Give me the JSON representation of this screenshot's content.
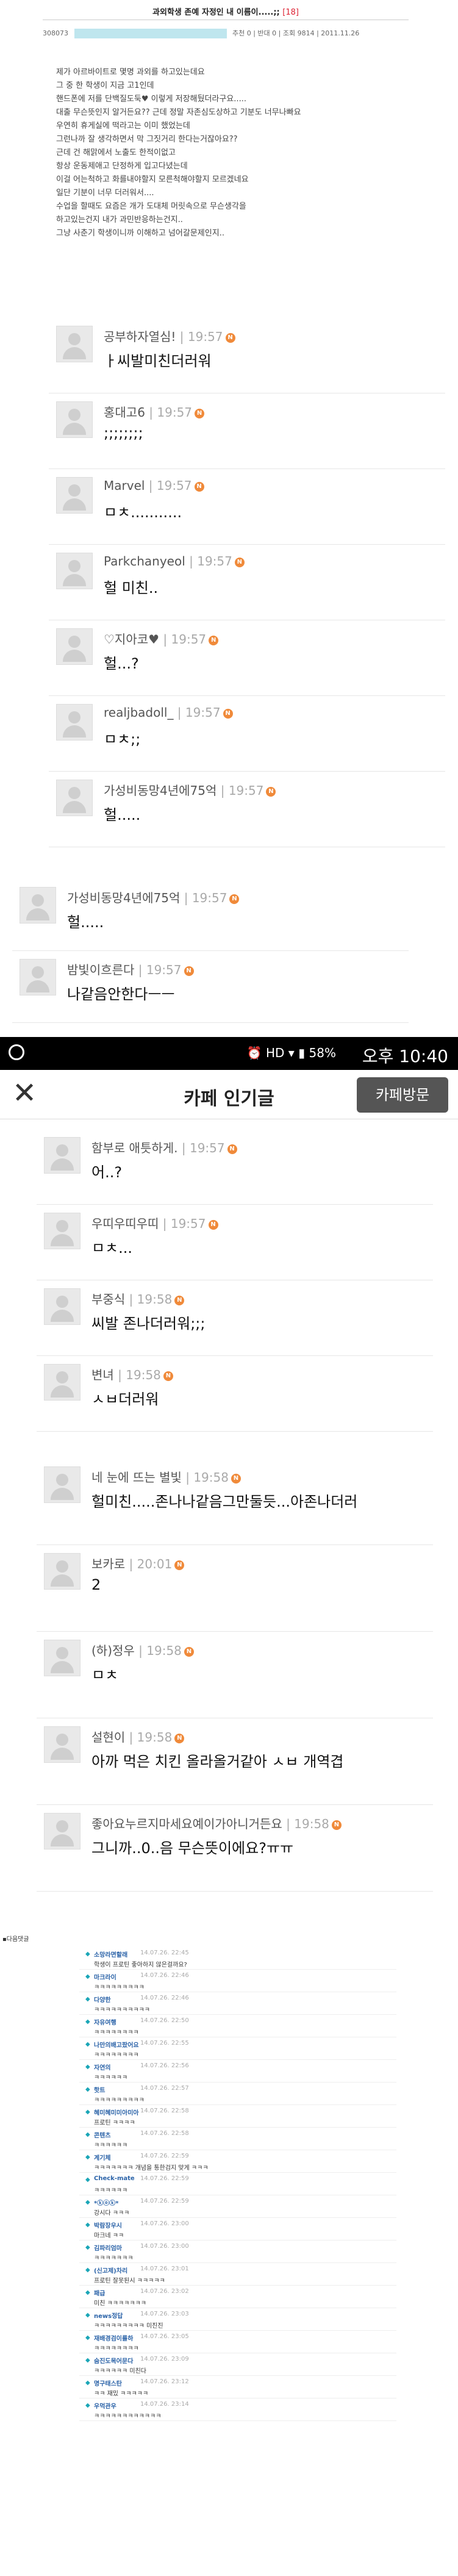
{
  "post": {
    "title": "과외학생 존예 자정인 내 이름이.....;;",
    "count": "[18]",
    "number": "308073",
    "stats": "추천 0 | 반대 0 | 조회 9814 | 2011.11.26",
    "body": [
      "제가 아르바이트로 몇명 과외를 하고있는데요",
      "그 중 한 학생이 지금 고1인데",
      "핸드폰에 저를 단백질도둑♥ 이렇게 저장해뒀더라구요.....",
      "대출 무슨뜻인지 알거든요?? 근데 정말 자존심도상하고 기분도 너무나빠요",
      "우연히 휴게실에 떡라고는 이미 했었는데",
      "그런나까 잘 생각하면서 막 그짓거리 한다는거잖아요??",
      "근데 건 해맑에서 노출도 한적이없고",
      "항상 운동제애고 단정하게 입고다녔는데",
      "이걸 어는척하고 화를내야할지 모른척해야할지 모르겠네요",
      "일단 기분이 너무 더러워서....",
      "수업을 할때도 요즘은 개가 도대체 머릿속으로 무슨생각을",
      "하고있는건지 내가 과민반응하는건지..",
      "그냥 사춘기 학생이니까 이해하고 넘어갈문제인지.."
    ]
  },
  "comments_a": [
    {
      "nick": "공부하자열심!",
      "time": "19:57",
      "text": "ㅏ씨발미친더러워"
    },
    {
      "nick": "홍대고6",
      "time": "19:57",
      "text": ";;;;;;;;"
    },
    {
      "nick": "Marvel",
      "time": "19:57",
      "text": "ㅁㅊ..........."
    },
    {
      "nick": "Parkchanyeol",
      "time": "19:57",
      "text": "헐 미친.."
    },
    {
      "nick": "♡지아코♥",
      "time": "19:57",
      "text": "헐...?"
    },
    {
      "nick": "realjbadoll_",
      "time": "19:57",
      "text": "ㅁㅊ;;"
    },
    {
      "nick": "가성비동망4년에75억",
      "time": "19:57",
      "text": "헐....."
    }
  ],
  "comments_b": [
    {
      "nick": "가성비동망4년에75억",
      "time": "19:57",
      "text": "헐....."
    },
    {
      "nick": "밤빛이흐른다",
      "time": "19:57",
      "text": "나같음안한다ㅡㅡ"
    }
  ],
  "statusbar": {
    "icons": "⏰ HD ▾ ▮ 58%",
    "time": "오후 10:40"
  },
  "appbar": {
    "close": "✕",
    "title": "카페 인기글",
    "visit": "카페방문"
  },
  "comments_c": [
    {
      "nick": "함부로 애틋하게.",
      "time": "19:57",
      "text": "어..?"
    },
    {
      "nick": "우띠우띠우띠",
      "time": "19:57",
      "text": "ㅁㅊ..."
    },
    {
      "nick": "부중식",
      "time": "19:58",
      "text": "씨발 존나더러워;;;"
    },
    {
      "nick": "변녀",
      "time": "19:58",
      "text": "ㅅㅂ더러워"
    }
  ],
  "comments_d": [
    {
      "nick": "네 눈에 뜨는 별빛",
      "time": "19:58",
      "text": "헐미친.....존나나같음그만둘듯...아존나더러"
    },
    {
      "nick": "보카로",
      "time": "20:01",
      "text": "2"
    },
    {
      "nick": "(하)정우",
      "time": "19:58",
      "text": "ㅁㅊ"
    },
    {
      "nick": "설현이",
      "time": "19:58",
      "text": "아까 먹은 치킨 올라올거같아 ㅅㅂ 개역겹"
    },
    {
      "nick": "좋아요누르지마세요예이가아니거든요",
      "time": "19:58",
      "text": "그니까..0..음 무슨뜻이에요?ㅠㅠ"
    }
  ],
  "mini_header": "▪다음댓글",
  "mini": [
    {
      "n": "소망라면할래",
      "d": "14.07.26. 22:45",
      "c": "학생이 프로틴 좋아하지 않은걸까요?"
    },
    {
      "n": "마크라이",
      "d": "14.07.26. 22:46",
      "c": "ㅋㅋㅋㅋㅋㅋㅋㅋㅋ"
    },
    {
      "n": "다양한",
      "d": "14.07.26. 22:46",
      "c": "ㅋㅋㅋㅋㅋㅋㅋㅋㅋㅋ"
    },
    {
      "n": "자유여행",
      "d": "14.07.26. 22:50",
      "c": "ㅋㅋㅋㅋㅋㅋㅋㅋ"
    },
    {
      "n": "나만의배고팠어요",
      "d": "14.07.26. 22:55",
      "c": "ㅋㅋㅋㅋㅋㅋㅋㅋ"
    },
    {
      "n": "자연의",
      "d": "14.07.26. 22:56",
      "c": "ㅋㅋㅋㅋㅋㅋ"
    },
    {
      "n": "핫트",
      "d": "14.07.26. 22:57",
      "c": "ㅋㅋㅋㅋㅋㅋㅋㅋㅋ"
    },
    {
      "n": "혜미혜미미아미아",
      "d": "14.07.26. 22:58",
      "c": "프로틴 ㅋㅋㅋㅋ"
    },
    {
      "n": "콘텐츠",
      "d": "14.07.26. 22:58",
      "c": "ㅋㅋㅋㅋㅋㅋ"
    },
    {
      "n": "계기체",
      "d": "14.07.26. 22:59",
      "c": "ㅋㅋㅋㅋㅋㅋㅋ 개념을 통한검지 맞게 ㅋㅋㅋ"
    },
    {
      "n": "Check-mate",
      "d": "14.07.26. 22:59",
      "c": "ㅋㅋㅋㅋㅋㅋ"
    },
    {
      "n": "*ⓚⓞⓚ*",
      "d": "14.07.26. 22:59",
      "c": "강시다 ㅋㅋㅋ"
    },
    {
      "n": "박람장우시",
      "d": "14.07.26. 23:00",
      "c": "마크네 ㅋㅋ"
    },
    {
      "n": "김파리엄마",
      "d": "14.07.26. 23:00",
      "c": "ㅋㅋㅋㅋㅋㅋㅋ"
    },
    {
      "n": "(신고제)차리",
      "d": "14.07.26. 23:01",
      "c": "프로틴 잘못된시 ㅋㅋㅋㅋㅋ"
    },
    {
      "n": "패급",
      "d": "14.07.26. 23:02",
      "c": "미친 ㅋㅋㅋㅋㅋㅋㅋ"
    },
    {
      "n": "news정답",
      "d": "14.07.26. 23:03",
      "c": "ㅋㅋㅋㅋㅋㅋㅋㅋㅋ 미진진"
    },
    {
      "n": "재배경검이를하",
      "d": "14.07.26. 23:05",
      "c": "ㅋㅋㅋㅋㅋㅋㅋㅋ"
    },
    {
      "n": "숨진도목어문다",
      "d": "14.07.26. 23:09",
      "c": "ㅋㅋㅋㅋㅋㅋ 미친다"
    },
    {
      "n": "명구태스탄",
      "d": "14.07.26. 23:12",
      "c": "ㅋㅋ 재밌 ㅋㅋㅋㅋㅋ"
    },
    {
      "n": "우먹관우",
      "d": "14.07.26. 23:14",
      "c": "ㅋㅋㅋㅋㅋㅋㅋㅋㅋㅋㅋㅋ"
    }
  ]
}
